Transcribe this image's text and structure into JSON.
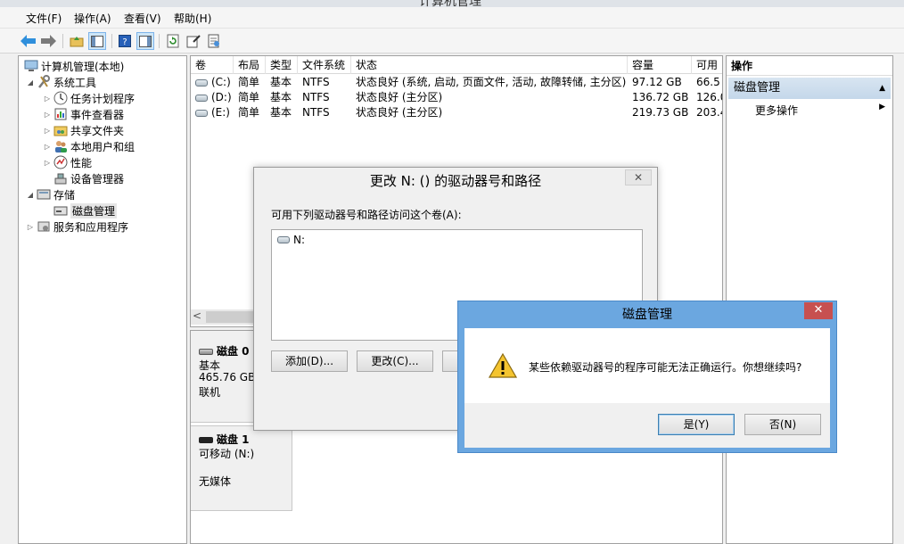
{
  "window": {
    "title": "计算机管理"
  },
  "menu": [
    "文件(F)",
    "操作(A)",
    "查看(V)",
    "帮助(H)"
  ],
  "tree": {
    "root": "计算机管理(本地)",
    "items": [
      {
        "label": "系统工具",
        "level": 1,
        "expanded": true
      },
      {
        "label": "任务计划程序",
        "level": 2
      },
      {
        "label": "事件查看器",
        "level": 2
      },
      {
        "label": "共享文件夹",
        "level": 2
      },
      {
        "label": "本地用户和组",
        "level": 2
      },
      {
        "label": "性能",
        "level": 2
      },
      {
        "label": "设备管理器",
        "level": 2
      },
      {
        "label": "存储",
        "level": 1,
        "expanded": true
      },
      {
        "label": "磁盘管理",
        "level": 2,
        "selected": true
      },
      {
        "label": "服务和应用程序",
        "level": 1
      }
    ]
  },
  "volumes": {
    "columns": [
      "卷",
      "布局",
      "类型",
      "文件系统",
      "状态",
      "容量",
      "可用"
    ],
    "rows": [
      [
        "(C:)",
        "简单",
        "基本",
        "NTFS",
        "状态良好 (系统, 启动, 页面文件, 活动, 故障转储, 主分区)",
        "97.12 GB",
        "66.5"
      ],
      [
        "(D:)",
        "简单",
        "基本",
        "NTFS",
        "状态良好 (主分区)",
        "136.72 GB",
        "126.0"
      ],
      [
        "(E:)",
        "简单",
        "基本",
        "NTFS",
        "状态良好 (主分区)",
        "219.73 GB",
        "203.4"
      ]
    ]
  },
  "disks": [
    {
      "name": "磁盘 0",
      "type": "基本",
      "size": "465.76 GB",
      "status": "联机"
    },
    {
      "name": "磁盘 1",
      "type": "可移动 (N:)",
      "status": "无媒体"
    }
  ],
  "actions": {
    "header": "操作",
    "section": "磁盘管理",
    "more": "更多操作"
  },
  "change_dialog": {
    "title": "更改 N: () 的驱动器号和路径",
    "label": "可用下列驱动器号和路径访问这个卷(A):",
    "entry": "N:",
    "add": "添加(D)...",
    "change": "更改(C)..."
  },
  "confirm_dialog": {
    "title": "磁盘管理",
    "message": "某些依赖驱动器号的程序可能无法正确运行。你想继续吗?",
    "yes": "是(Y)",
    "no": "否(N)"
  },
  "colors": {
    "dialog_frame": "#6ba7e0",
    "close_red": "#c75050",
    "section_blue": "#c4d7ea"
  }
}
